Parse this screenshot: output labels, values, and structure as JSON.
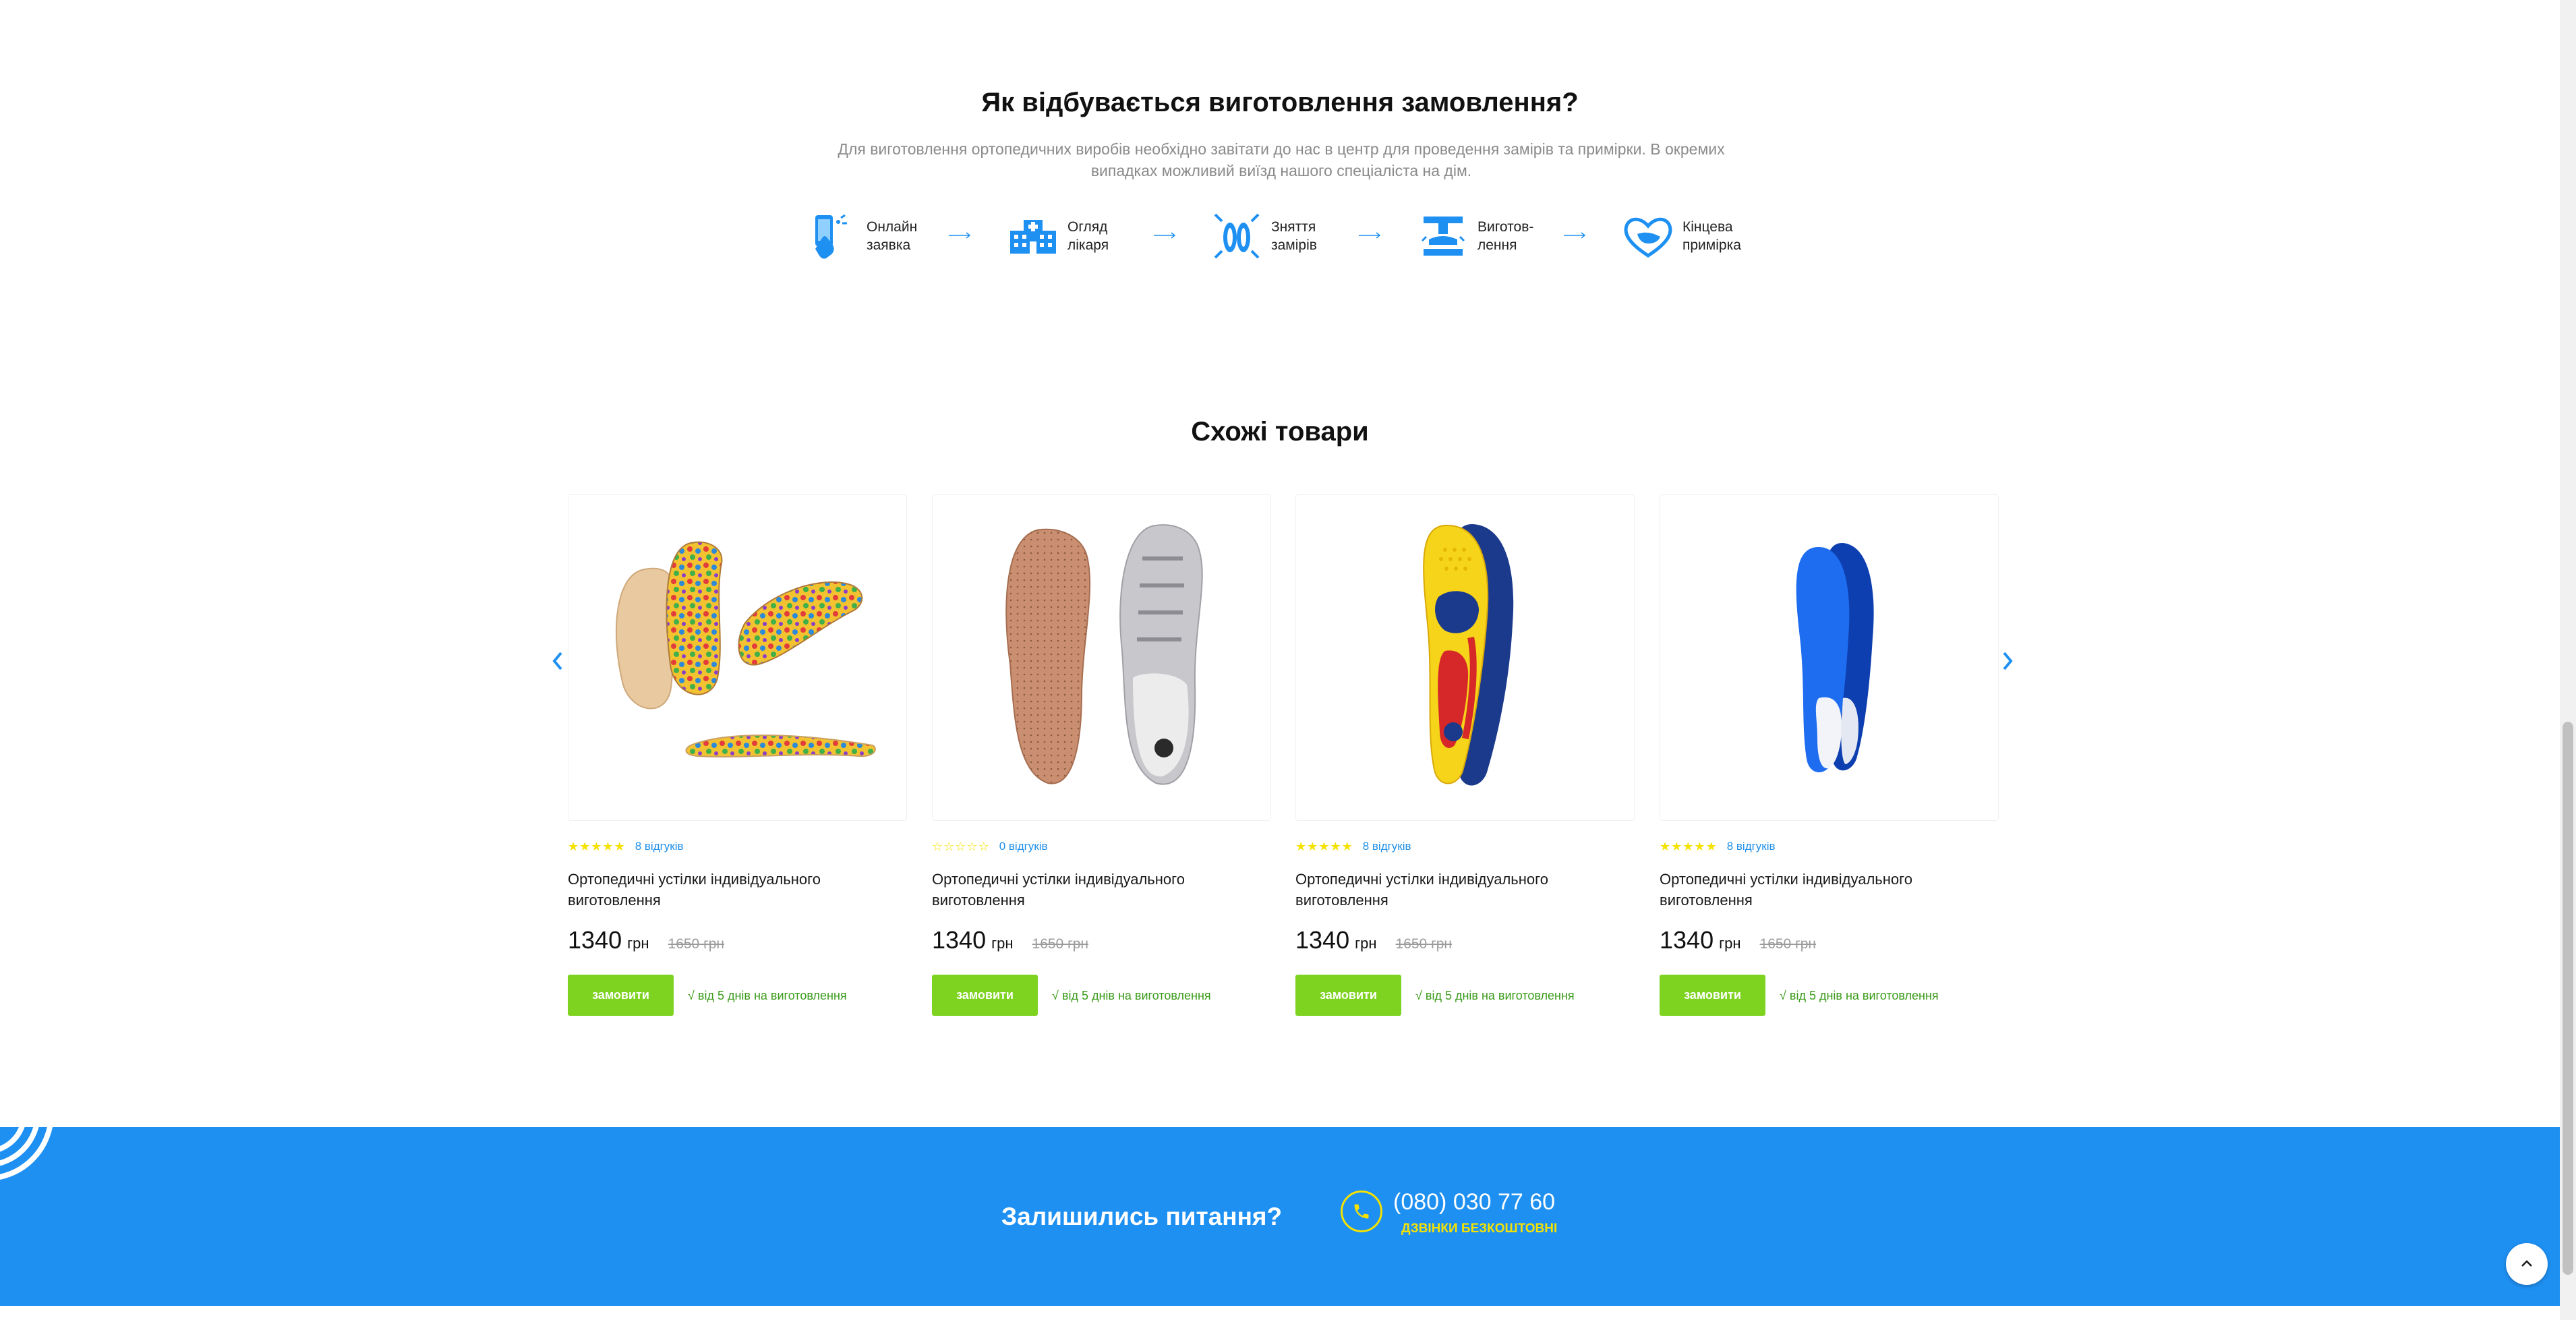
{
  "process": {
    "title": "Як відбувається виготовлення замовлення?",
    "lead": "Для виготовлення ортопедичних виробів необхідно завітати до нас в центр для проведення замірів та примірки. В окремих випадках можливий виїзд нашого спеціаліста на дім.",
    "steps": [
      {
        "label": "Онлайн\nзаявка",
        "icon": "phone-touch-icon"
      },
      {
        "label": "Огляд\nлікаря",
        "icon": "clinic-building-icon"
      },
      {
        "label": "Зняття\nзамірів",
        "icon": "footprint-measure-icon"
      },
      {
        "label": "Виготов-\nлення",
        "icon": "manufacturing-icon"
      },
      {
        "label": "Кінцева\nпримірка",
        "icon": "foot-heart-icon"
      }
    ]
  },
  "similar": {
    "title": "Схожі товари",
    "products": [
      {
        "rating": 5,
        "reviews": "8 відгуків",
        "name": "Ортопедичні устілки індивідуального виготовлення",
        "price": "1340",
        "unit": "грн",
        "old_price": "1650 грн",
        "button": "замовити",
        "term": "√ від 5 днів на виготовлення"
      },
      {
        "rating": 0,
        "reviews": "0 відгуків",
        "name": "Ортопедичні устілки індивідуального виготовлення",
        "price": "1340",
        "unit": "грн",
        "old_price": "1650 грн",
        "button": "замовити",
        "term": "√ від 5 днів на виготовлення"
      },
      {
        "rating": 5,
        "reviews": "8 відгуків",
        "name": "Ортопедичні устілки індивідуального виготовлення",
        "price": "1340",
        "unit": "грн",
        "old_price": "1650 грн",
        "button": "замовити",
        "term": "√ від 5 днів на виготовлення"
      },
      {
        "rating": 5,
        "reviews": "8 відгуків",
        "name": "Ортопедичні устілки індивідуального виготовлення",
        "price": "1340",
        "unit": "грн",
        "old_price": "1650 грн",
        "button": "замовити",
        "term": "√ від 5 днів на виготовлення"
      }
    ]
  },
  "footer": {
    "question": "Залишились питання?",
    "phone": "(080) 030 77 60",
    "free_call": "ДЗВІНКИ БЕЗКОШТОВНІ"
  },
  "colors": {
    "accent": "#1e90f2",
    "button": "#7ed321",
    "star": "#f5e200",
    "term": "#3a9b1a"
  }
}
